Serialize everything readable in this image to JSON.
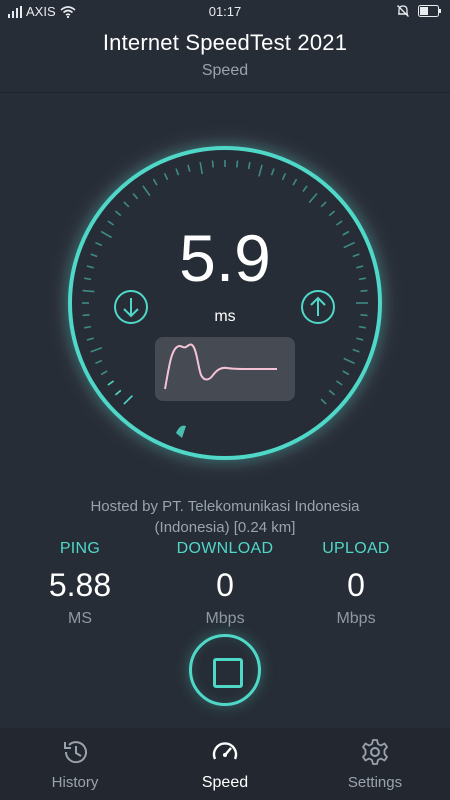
{
  "status_bar": {
    "carrier": "AXIS",
    "time": "01:17",
    "icons": [
      "signal-icon",
      "wifi-icon",
      "alarm-muted-icon",
      "battery-icon"
    ]
  },
  "header": {
    "title": "Internet SpeedTest 2021",
    "subtitle": "Speed"
  },
  "gauge": {
    "value": "5.9",
    "unit": "ms",
    "left_icon": "arrow-down-circle-icon",
    "right_icon": "arrow-up-circle-icon"
  },
  "host": {
    "line1": "Hosted by PT. Telekomunikasi Indonesia",
    "line2": "(Indonesia) [0.24 km]"
  },
  "stats": {
    "ping": {
      "label": "PING",
      "value": "5.88",
      "unit": "MS"
    },
    "download": {
      "label": "DOWNLOAD",
      "value": "0",
      "unit": "Mbps"
    },
    "upload": {
      "label": "UPLOAD",
      "value": "0",
      "unit": "Mbps"
    }
  },
  "controls": {
    "stop_icon": "stop-icon"
  },
  "nav": {
    "history": {
      "label": "History",
      "icon": "history-icon"
    },
    "speed": {
      "label": "Speed",
      "icon": "speedometer-icon"
    },
    "settings": {
      "label": "Settings",
      "icon": "gear-icon"
    }
  },
  "colors": {
    "background": "#272d36",
    "accent": "#4fd8c8",
    "graph_line": "#f6c3d6",
    "nav_background": "#232830"
  }
}
